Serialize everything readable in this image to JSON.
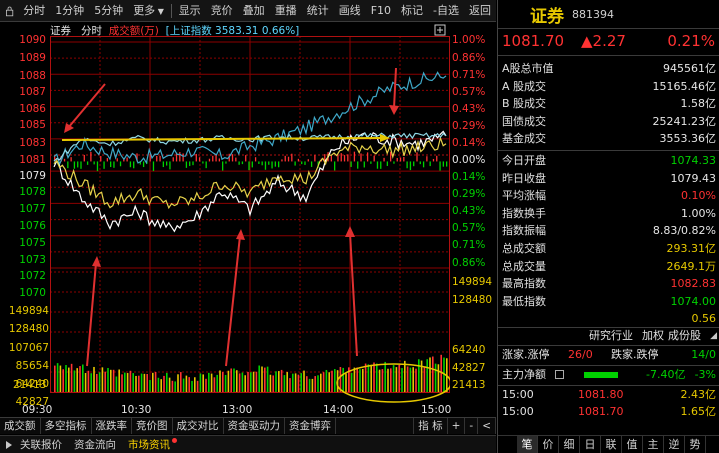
{
  "toolbar": {
    "items": [
      "分时",
      "1分钟",
      "5分钟",
      "更多",
      "显示",
      "竞价",
      "叠加",
      "重播",
      "统计",
      "画线",
      "F10",
      "标记",
      "-自选",
      "返回"
    ]
  },
  "chart_header": {
    "name": "证券",
    "mode": "分时",
    "volume_label": "成交额(万)",
    "overlay": "[上证指数",
    "overlay_value": "3583.31",
    "overlay_pct": "0.66%]"
  },
  "price_axis": {
    "left": [
      "1090",
      "1089",
      "1088",
      "1087",
      "1086",
      "1085",
      "1083",
      "1081",
      "1079",
      "1078",
      "1077",
      "1076",
      "1075",
      "1073",
      "1072",
      "1070"
    ],
    "right": [
      "1.00%",
      "0.86%",
      "0.71%",
      "0.57%",
      "0.43%",
      "0.29%",
      "0.14%",
      "0.00%",
      "0.14%",
      "0.29%",
      "0.43%",
      "0.57%",
      "0.71%",
      "0.86%"
    ]
  },
  "volume_axis": {
    "left": [
      "149894",
      "128480",
      "107067",
      "85654",
      "64240",
      "42827",
      "21413"
    ],
    "right": [
      "149894",
      "128480",
      "64240",
      "42827",
      "21413"
    ]
  },
  "time_axis": [
    "09:30",
    "10:30",
    "13:00",
    "14:00",
    "15:00"
  ],
  "chart_data": {
    "type": "line",
    "x_labels": [
      "09:30",
      "10:30",
      "13:00",
      "14:00",
      "15:00"
    ],
    "prev_close": 1079.43,
    "ylim": [
      1070,
      1090
    ],
    "series": [
      {
        "values": [
          1079.4,
          1081.0,
          1080.2,
          1079.8,
          1080.0,
          1080.4,
          1079.9,
          1080.8,
          1081.5,
          1082.4,
          1083.6,
          1084.8,
          1085.9,
          1086.6,
          1087.0
        ]
      },
      {
        "values": [
          1079.4,
          1076.2,
          1074.0,
          1075.0,
          1073.5,
          1074.4,
          1076.8,
          1075.2,
          1077.6,
          1076.3,
          1080.6,
          1081.8,
          1081.3,
          1081.0,
          1081.7
        ]
      },
      {
        "values": [
          1079.4,
          1077.5,
          1075.8,
          1076.6,
          1075.6,
          1076.0,
          1077.5,
          1076.6,
          1078.3,
          1077.8,
          1080.2,
          1080.8,
          1080.4,
          1080.6,
          1081.0
        ]
      },
      {
        "values": [
          1079.4,
          1081.4,
          1081.0,
          1081.5,
          1081.2,
          1081.3,
          1081.5,
          1081.4,
          1081.6,
          1081.5,
          1081.6,
          1081.7,
          1081.7,
          1081.7,
          1081.7
        ]
      }
    ],
    "volume_ylim": [
      0,
      160000
    ],
    "volume_series": [
      40000,
      30000,
      25000,
      22000,
      20000,
      21000,
      24000,
      30000,
      26000,
      22000,
      28000,
      35000,
      33000,
      38000,
      45000
    ]
  },
  "bottom_tabs": [
    "成交额",
    "多空指标",
    "涨跌率",
    "竞价图",
    "成交对比",
    "资金驱动力",
    "资金博弈"
  ],
  "bottom_tools": {
    "label": "指 标",
    "plus": "+",
    "minus": "-"
  },
  "status_bar": [
    "关联报价",
    "资金流向",
    "市场资讯"
  ],
  "quote": {
    "name": "证券",
    "code": "881394",
    "price": "1081.70",
    "change": "▲2.27",
    "change_pct": "0.21%"
  },
  "stats_a": [
    {
      "k": "A股总市值",
      "v": "945561亿",
      "color": "white"
    },
    {
      "k": "A 股成交",
      "v": "15165.46亿",
      "color": "white"
    },
    {
      "k": "B 股成交",
      "v": "1.58亿",
      "color": "white"
    },
    {
      "k": "国债成交",
      "v": "25241.23亿",
      "color": "white"
    },
    {
      "k": "基金成交",
      "v": "3553.36亿",
      "color": "white"
    }
  ],
  "stats_b": [
    {
      "k": "今日开盘",
      "v": "1074.33",
      "color": "green"
    },
    {
      "k": "昨日收盘",
      "v": "1079.43",
      "color": "white"
    },
    {
      "k": "平均涨幅",
      "v": "0.10%",
      "color": "red"
    },
    {
      "k": "指数换手",
      "v": "1.00%",
      "color": "white"
    },
    {
      "k": "指数振幅",
      "v": "8.83/0.82%",
      "color": "white"
    },
    {
      "k": "总成交额",
      "v": "293.31亿",
      "color": "yellow"
    },
    {
      "k": "总成交量",
      "v": "2649.1万",
      "color": "yellow"
    },
    {
      "k": "最高指数",
      "v": "1082.83",
      "color": "red"
    },
    {
      "k": "最低指数",
      "v": "1074.00",
      "color": "green"
    },
    {
      "k": "",
      "v": "0.56",
      "color": "yellow"
    }
  ],
  "industry": {
    "label": "研究行业",
    "weight": "加权",
    "constituents": "成份股"
  },
  "breadth": {
    "up_label": "涨家.涨停",
    "up_value": "26/0",
    "down_label": "跌家.跌停",
    "down_value": "14/0"
  },
  "net_flow": {
    "label": "主力净额",
    "value": "-7.40亿",
    "pct": "-3%"
  },
  "ticks": [
    {
      "time": "15:00",
      "price": "1081.80",
      "amount": "2.43亿"
    },
    {
      "time": "15:00",
      "price": "1081.70",
      "amount": "1.65亿"
    }
  ],
  "panel_tabs": [
    "笔",
    "价",
    "细",
    "日",
    "联",
    "值",
    "主",
    "逆",
    "势"
  ],
  "colors": {
    "up": "#ff3232",
    "down": "#00d200",
    "grid": "#8b0000",
    "highlight": "#e6c800",
    "accent": "#5fd7ff"
  }
}
